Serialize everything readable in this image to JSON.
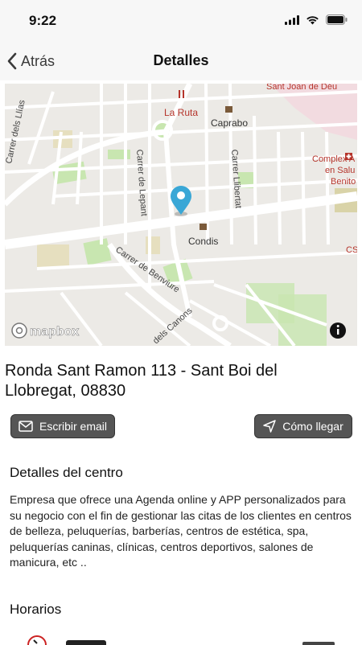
{
  "status_bar": {
    "time": "9:22"
  },
  "nav": {
    "back_label": "Atrás",
    "title": "Detalles"
  },
  "map": {
    "attribution": "mapbox",
    "labels": {
      "la_ruta": "La Ruta",
      "caprabo": "Caprabo",
      "condis": "Condis",
      "sant_joan": "Sant Joan de Déu",
      "complex_1": "Complex A",
      "complex_2": "en Salu",
      "complex_3": "Benito",
      "cs": "CS",
      "carrer_lepant": "Carrer de Lepant",
      "carrer_lliberta": "Carrer Llibertat",
      "carrer_benviure": "Carrer de Benviure",
      "carrer_canons": "dels Canons",
      "carrer_llias": "Carrer dels Llías"
    },
    "colors": {
      "background": "#eceae6",
      "road": "#ffffff",
      "park": "#c8e6b0",
      "poi_red": "#b5342b",
      "pin": "#3aa7d6"
    }
  },
  "address": "Ronda Sant Ramon 113 - Sant Boi del Llobregat, 08830",
  "actions": {
    "email_label": "Escribir email",
    "route_label": "Cómo llegar"
  },
  "details": {
    "title": "Detalles del centro",
    "description": "Empresa que ofrece una Agenda online y APP personalizados para su negocio con el fin de gestionar las citas de los clientes en centros de belleza, peluquerías, barberías, centros de estética, spa, peluquerías caninas, clínicas, centros deportivos, salones de manicura, etc .."
  },
  "hours": {
    "title": "Horarios"
  }
}
